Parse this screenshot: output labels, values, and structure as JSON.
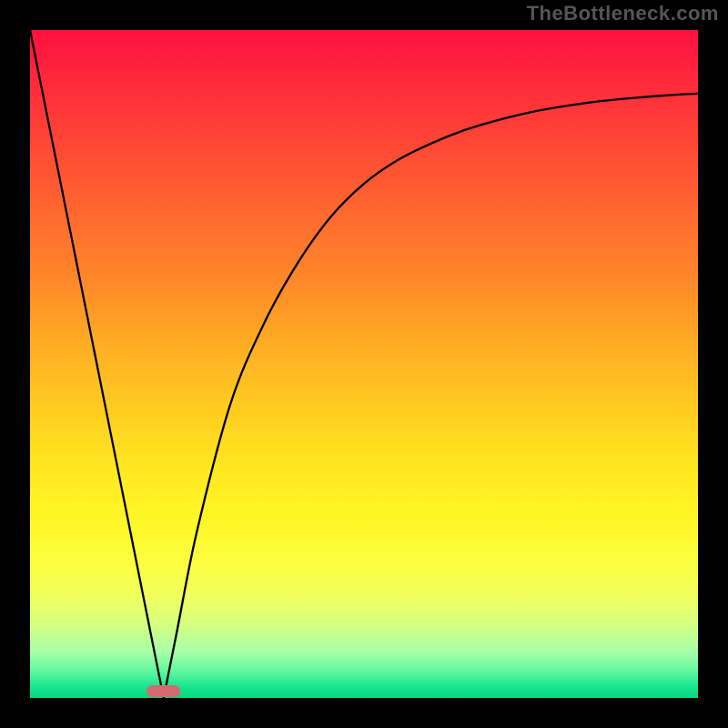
{
  "watermark": "TheBottleneck.com",
  "chart_data": {
    "type": "line",
    "title": "",
    "xlabel": "",
    "ylabel": "",
    "xlim": [
      0,
      100
    ],
    "ylim": [
      0,
      100
    ],
    "series": [
      {
        "name": "curve",
        "x": [
          0,
          5,
          10,
          15,
          18,
          20,
          22,
          25,
          30,
          35,
          40,
          45,
          50,
          55,
          60,
          65,
          70,
          75,
          80,
          85,
          90,
          95,
          100
        ],
        "values": [
          100,
          75,
          50,
          25,
          10,
          0,
          10,
          25,
          44,
          56,
          65,
          72,
          77,
          80.5,
          83,
          85,
          86.5,
          87.7,
          88.6,
          89.3,
          89.8,
          90.2,
          90.5
        ]
      }
    ],
    "marker": {
      "x_center": 20,
      "width_pct": 5
    },
    "background_gradient": {
      "top": "#ff1040",
      "mid": "#ffe820",
      "bottom": "#00d880"
    }
  }
}
